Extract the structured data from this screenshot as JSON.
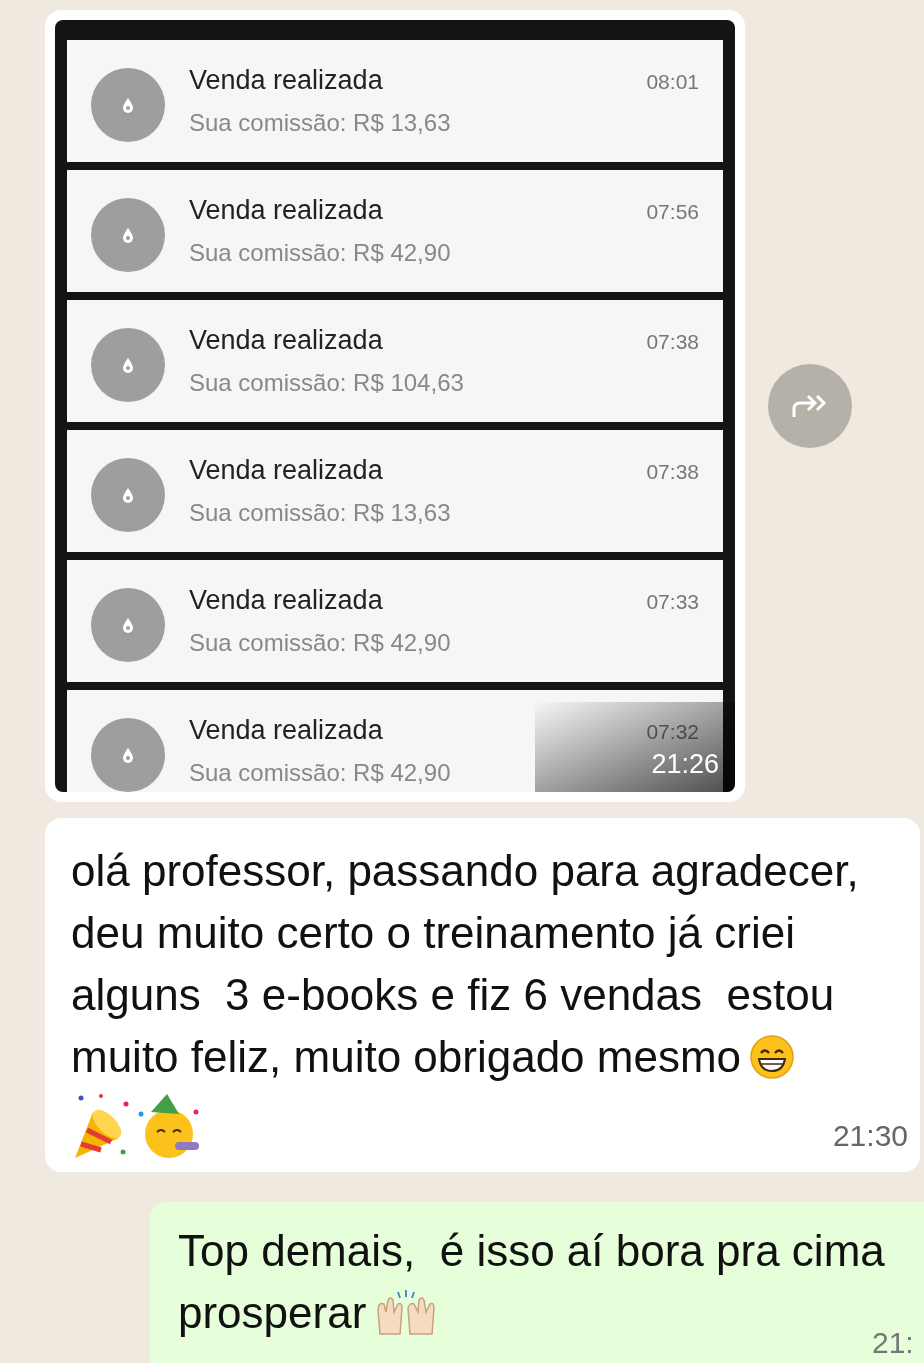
{
  "image_message": {
    "notifications": [
      {
        "title": "Venda realizada",
        "body": "Sua comissão: R$ 13,63",
        "time": "08:01"
      },
      {
        "title": "Venda realizada",
        "body": "Sua comissão: R$ 42,90",
        "time": "07:56"
      },
      {
        "title": "Venda realizada",
        "body": "Sua comissão: R$ 104,63",
        "time": "07:38"
      },
      {
        "title": "Venda realizada",
        "body": "Sua comissão: R$ 13,63",
        "time": "07:38"
      },
      {
        "title": "Venda realizada",
        "body": "Sua comissão: R$ 42,90",
        "time": "07:33"
      },
      {
        "title": "Venda realizada",
        "body": "Sua comissão: R$ 42,90",
        "time": "07:32"
      }
    ],
    "time": "21:26"
  },
  "incoming_message": {
    "lines": [
      "olá professor, passando para agradecer,",
      "deu muito certo o treinamento já criei",
      "alguns  3 e-books e fiz 6 vendas  estou",
      "muito feliz, muito obrigado mesmo"
    ],
    "time": "21:30"
  },
  "outgoing_message": {
    "lines": [
      "Top demais,  é isso aí bora pra cima",
      "prosperar"
    ],
    "time": "21:"
  }
}
